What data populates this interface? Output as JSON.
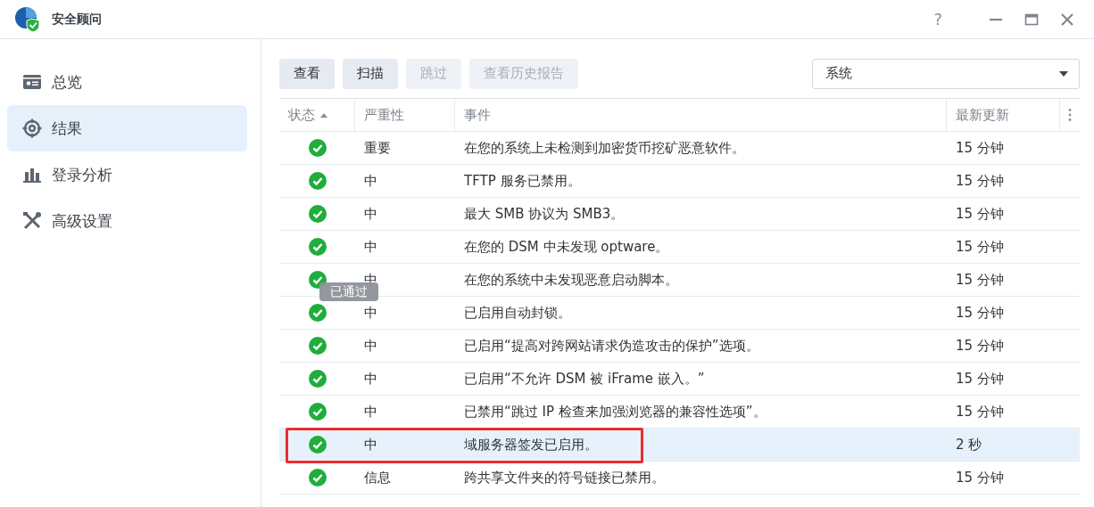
{
  "window": {
    "title": "安全顾问",
    "help": "?"
  },
  "sidebar": {
    "items": [
      {
        "label": "总览",
        "selected": false
      },
      {
        "label": "结果",
        "selected": true
      },
      {
        "label": "登录分析",
        "selected": false
      },
      {
        "label": "高级设置",
        "selected": false
      }
    ]
  },
  "toolbar": {
    "buttons": [
      {
        "label": "查看",
        "disabled": false
      },
      {
        "label": "扫描",
        "disabled": false
      },
      {
        "label": "跳过",
        "disabled": true
      },
      {
        "label": "查看历史报告",
        "disabled": true
      }
    ],
    "filter": {
      "value": "系统"
    }
  },
  "table": {
    "columns": [
      {
        "label": "状态",
        "sorted": true
      },
      {
        "label": "严重性",
        "sorted": false
      },
      {
        "label": "事件",
        "sorted": false
      },
      {
        "label": "最新更新",
        "sorted": false
      }
    ],
    "rows": [
      {
        "passed": true,
        "severity": "重要",
        "event": "在您的系统上未检测到加密货币挖矿恶意软件。",
        "updated": "15 分钟",
        "selected": false,
        "annotated": false
      },
      {
        "passed": true,
        "severity": "中",
        "event": "TFTP 服务已禁用。",
        "updated": "15 分钟",
        "selected": false,
        "annotated": false
      },
      {
        "passed": true,
        "severity": "中",
        "event": "最大 SMB 协议为 SMB3。",
        "updated": "15 分钟",
        "selected": false,
        "annotated": false
      },
      {
        "passed": true,
        "severity": "中",
        "event": "在您的 DSM 中未发现 optware。",
        "updated": "15 分钟",
        "selected": false,
        "annotated": false
      },
      {
        "passed": true,
        "severity": "中",
        "event": "在您的系统中未发现恶意启动脚本。",
        "updated": "15 分钟",
        "selected": false,
        "annotated": false
      },
      {
        "passed": true,
        "severity": "中",
        "event": "已启用自动封锁。",
        "updated": "15 分钟",
        "selected": false,
        "annotated": false
      },
      {
        "passed": true,
        "severity": "中",
        "event": "已启用“提高对跨网站请求伪造攻击的保护”选项。",
        "updated": "15 分钟",
        "selected": false,
        "annotated": false
      },
      {
        "passed": true,
        "severity": "中",
        "event": "已启用“不允许 DSM 被 iFrame 嵌入。”",
        "updated": "15 分钟",
        "selected": false,
        "annotated": false
      },
      {
        "passed": true,
        "severity": "中",
        "event": "已禁用“跳过 IP 检查来加强浏览器的兼容性选项”。",
        "updated": "15 分钟",
        "selected": false,
        "annotated": false
      },
      {
        "passed": true,
        "severity": "中",
        "event": "域服务器签发已启用。",
        "updated": "2 秒",
        "selected": true,
        "annotated": true
      },
      {
        "passed": true,
        "severity": "信息",
        "event": "跨共享文件夹的符号链接已禁用。",
        "updated": "15 分钟",
        "selected": false,
        "annotated": false
      }
    ],
    "tooltip": {
      "text": "已通过"
    }
  }
}
